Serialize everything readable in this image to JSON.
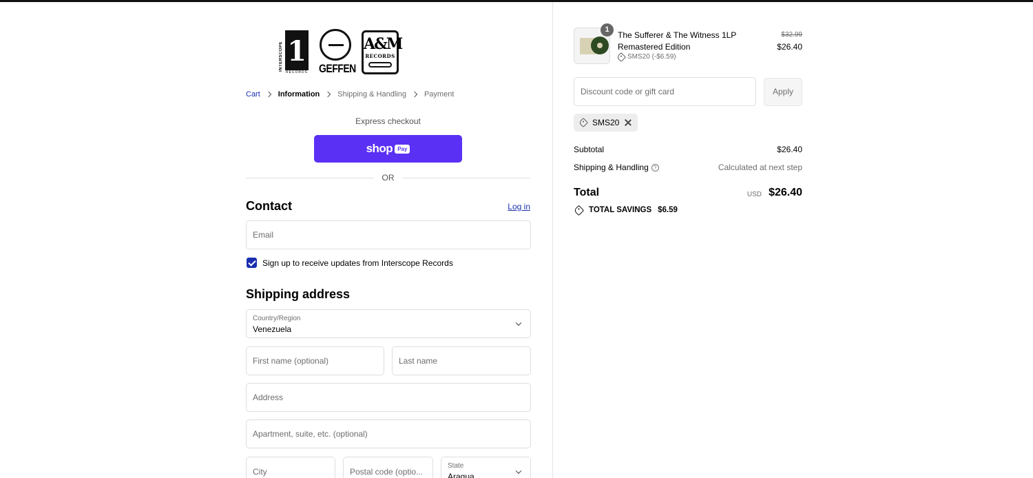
{
  "brand": {
    "logos": [
      {
        "name": "Interscope Records",
        "mark": "1",
        "side_text": "INTERSCOPE",
        "sub_text": "RECORDS"
      },
      {
        "name": "Geffen",
        "text": "GEFFEN"
      },
      {
        "name": "A&M Records",
        "text": "A&M",
        "sub_text": "RECORDS"
      }
    ]
  },
  "breadcrumb": {
    "cart": "Cart",
    "information": "Information",
    "shipping": "Shipping & Handling",
    "payment": "Payment"
  },
  "express": {
    "label": "Express checkout",
    "shop_text": "shop",
    "pay_text": "Pay",
    "or_text": "OR"
  },
  "contact": {
    "heading": "Contact",
    "login": "Log in",
    "email_placeholder": "Email",
    "signup_label": "Sign up to receive updates from Interscope Records",
    "signup_checked": true
  },
  "shipping": {
    "heading": "Shipping address",
    "country_label": "Country/Region",
    "country_value": "Venezuela",
    "first_name_placeholder": "First name (optional)",
    "last_name_placeholder": "Last name",
    "address_placeholder": "Address",
    "apartment_placeholder": "Apartment, suite, etc. (optional)",
    "city_placeholder": "City",
    "postal_placeholder": "Postal code (optio...",
    "state_label": "State",
    "state_value": "Aragua"
  },
  "summary": {
    "item": {
      "quantity": "1",
      "title": "The Sufferer & The Witness 1LP Remastered Edition",
      "discount": "SMS20 (-$6.59)",
      "original_price": "$32.99",
      "price": "$26.40"
    },
    "discount_placeholder": "Discount code or gift card",
    "apply_label": "Apply",
    "applied_code": "SMS20",
    "subtotal_label": "Subtotal",
    "subtotal_value": "$26.40",
    "shipping_label": "Shipping & Handling",
    "shipping_value": "Calculated at next step",
    "total_label": "Total",
    "currency": "USD",
    "total_value": "$26.40",
    "savings_label": "TOTAL SAVINGS",
    "savings_value": "$6.59"
  },
  "colors": {
    "accent": "#1a2fb0",
    "shop_pay": "#5a31f4"
  }
}
